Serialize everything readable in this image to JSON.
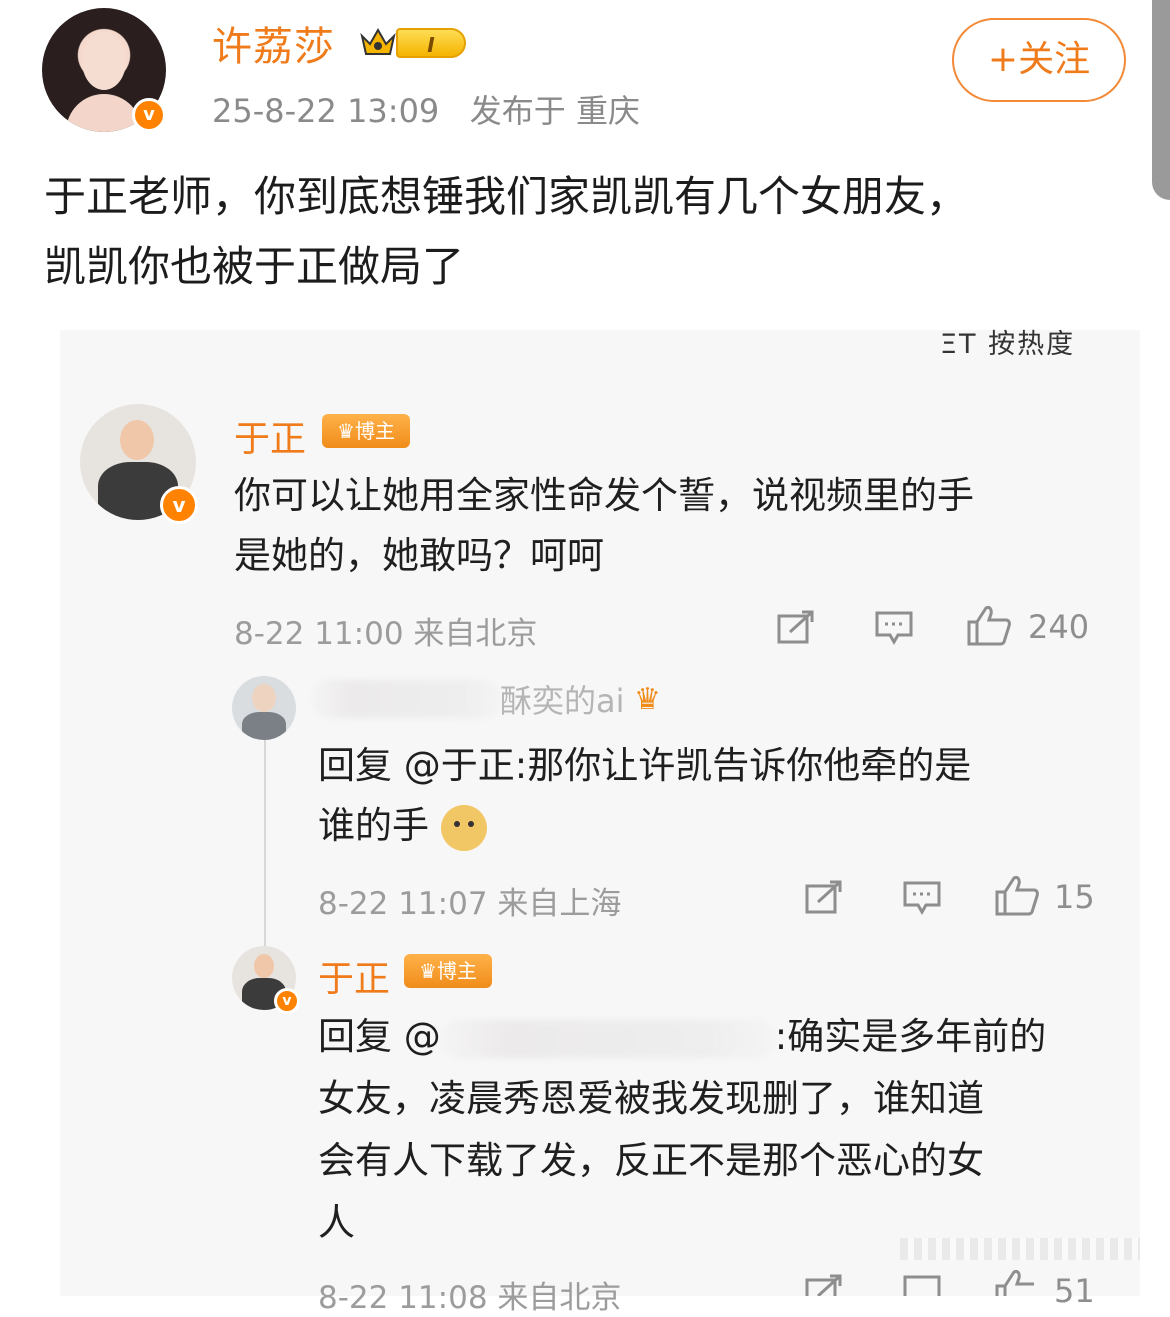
{
  "post": {
    "author": "许荔莎",
    "level": "I",
    "time": "25-8-22 13:09",
    "location": "发布于 重庆",
    "follow_label": "+关注",
    "text_line1": "于正老师，你到底想锤我们家凯凯有几个女朋友，",
    "text_line2": "凯凯你也被于正做局了"
  },
  "screenshot": {
    "sort_label": "ΞT 按热度",
    "comments": [
      {
        "name": "于正",
        "badge": "博主",
        "text_line1": "你可以让她用全家性命发个誓，说视频里的手",
        "text_line2": "是她的，她敢吗？呵呵",
        "meta": "8-22 11:00 来自北京",
        "likes": "240"
      },
      {
        "name_visible": "酥奕的ai",
        "text_line1": "回复 @于正:那你让许凯告诉你他牵的是",
        "text_line2": "谁的手",
        "meta": "8-22 11:07 来自上海",
        "likes": "15"
      },
      {
        "name": "于正",
        "badge": "博主",
        "reply_prefix": "回复 @",
        "text_line1_tail": ":确实是多年前的",
        "text_line2": "女友，凌晨秀恩爱被我发现删了，谁知道",
        "text_line3": "会有人下载了发，反正不是那个恶心的女",
        "text_line4": "人",
        "meta": "8-22 11:08 来自北京",
        "likes": "51"
      }
    ]
  },
  "colors": {
    "accent": "#f07b1b",
    "verified": "#ff8200",
    "meta_gray": "#8a8a8a"
  }
}
